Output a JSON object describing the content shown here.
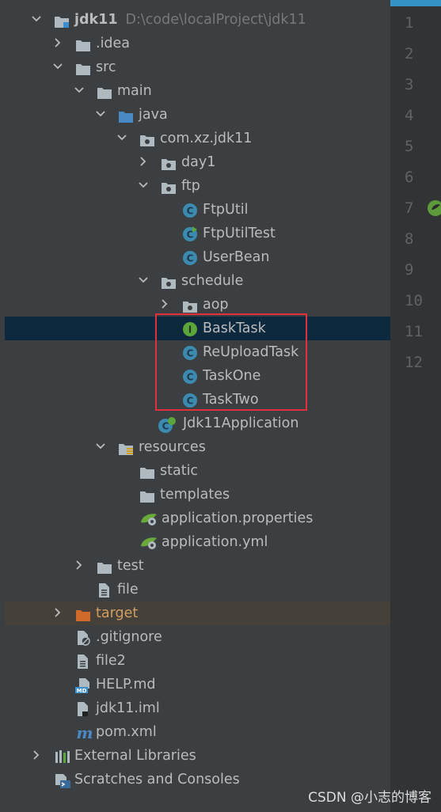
{
  "project": {
    "name": "jdk11",
    "path": "D:\\code\\localProject\\jdk11"
  },
  "tree": [
    {
      "label": "jdk11",
      "depth": 0,
      "arrow": "down",
      "icon": "module-folder-icon"
    },
    {
      "label": ".idea",
      "depth": 1,
      "arrow": "right",
      "icon": "folder-icon"
    },
    {
      "label": "src",
      "depth": 1,
      "arrow": "down",
      "icon": "folder-icon"
    },
    {
      "label": "main",
      "depth": 2,
      "arrow": "down",
      "icon": "folder-icon"
    },
    {
      "label": "java",
      "depth": 3,
      "arrow": "down",
      "icon": "source-folder-icon"
    },
    {
      "label": "com.xz.jdk11",
      "depth": 4,
      "arrow": "down",
      "icon": "package-icon"
    },
    {
      "label": "day1",
      "depth": 5,
      "arrow": "right",
      "icon": "package-icon"
    },
    {
      "label": "ftp",
      "depth": 5,
      "arrow": "down",
      "icon": "package-icon"
    },
    {
      "label": "FtpUtil",
      "depth": 6,
      "arrow": "",
      "icon": "class-icon"
    },
    {
      "label": "FtpUtilTest",
      "depth": 6,
      "arrow": "",
      "icon": "class-run-icon"
    },
    {
      "label": "UserBean",
      "depth": 6,
      "arrow": "",
      "icon": "class-icon"
    },
    {
      "label": "schedule",
      "depth": 5,
      "arrow": "down",
      "icon": "package-icon"
    },
    {
      "label": "aop",
      "depth": 6,
      "arrow": "right",
      "icon": "package-icon"
    },
    {
      "label": "BaskTask",
      "depth": 6,
      "arrow": "",
      "icon": "interface-icon"
    },
    {
      "label": "ReUploadTask",
      "depth": 6,
      "arrow": "",
      "icon": "class-icon"
    },
    {
      "label": "TaskOne",
      "depth": 6,
      "arrow": "",
      "icon": "class-icon"
    },
    {
      "label": "TaskTwo",
      "depth": 6,
      "arrow": "",
      "icon": "class-icon"
    },
    {
      "label": "Jdk11Application",
      "depth": 5,
      "arrow": "",
      "icon": "spring-app-icon"
    },
    {
      "label": "resources",
      "depth": 3,
      "arrow": "down",
      "icon": "resources-folder-icon"
    },
    {
      "label": "static",
      "depth": 4,
      "arrow": "",
      "icon": "folder-icon"
    },
    {
      "label": "templates",
      "depth": 4,
      "arrow": "",
      "icon": "folder-icon"
    },
    {
      "label": "application.properties",
      "depth": 4,
      "arrow": "",
      "icon": "spring-config-icon"
    },
    {
      "label": "application.yml",
      "depth": 4,
      "arrow": "",
      "icon": "spring-config-icon"
    },
    {
      "label": "test",
      "depth": 2,
      "arrow": "right",
      "icon": "folder-icon"
    },
    {
      "label": "file",
      "depth": 2,
      "arrow": "",
      "icon": "file-icon"
    },
    {
      "label": "target",
      "depth": 1,
      "arrow": "right",
      "icon": "excluded-folder-icon"
    },
    {
      "label": ".gitignore",
      "depth": 1,
      "arrow": "",
      "icon": "gitignore-icon"
    },
    {
      "label": "file2",
      "depth": 1,
      "arrow": "",
      "icon": "file-icon"
    },
    {
      "label": "HELP.md",
      "depth": 1,
      "arrow": "",
      "icon": "markdown-icon"
    },
    {
      "label": "jdk11.iml",
      "depth": 1,
      "arrow": "",
      "icon": "iml-icon"
    },
    {
      "label": "pom.xml",
      "depth": 1,
      "arrow": "",
      "icon": "maven-icon"
    },
    {
      "label": "External Libraries",
      "depth": 0,
      "arrow": "right",
      "icon": "libraries-icon"
    },
    {
      "label": "Scratches and Consoles",
      "depth": 0,
      "arrow": "",
      "icon": "scratches-icon"
    }
  ],
  "line_numbers": [
    "1",
    "2",
    "3",
    "4",
    "5",
    "6",
    "7",
    "8",
    "9",
    "10",
    "11",
    "12"
  ],
  "watermark": "CSDN @小志的博客",
  "colors": {
    "selected_row": "#0d293e",
    "excluded_row": "#45403a",
    "highlight_box": "#e0303a",
    "class_icon": "#3d8ab0",
    "interface_icon": "#5ca53a"
  }
}
